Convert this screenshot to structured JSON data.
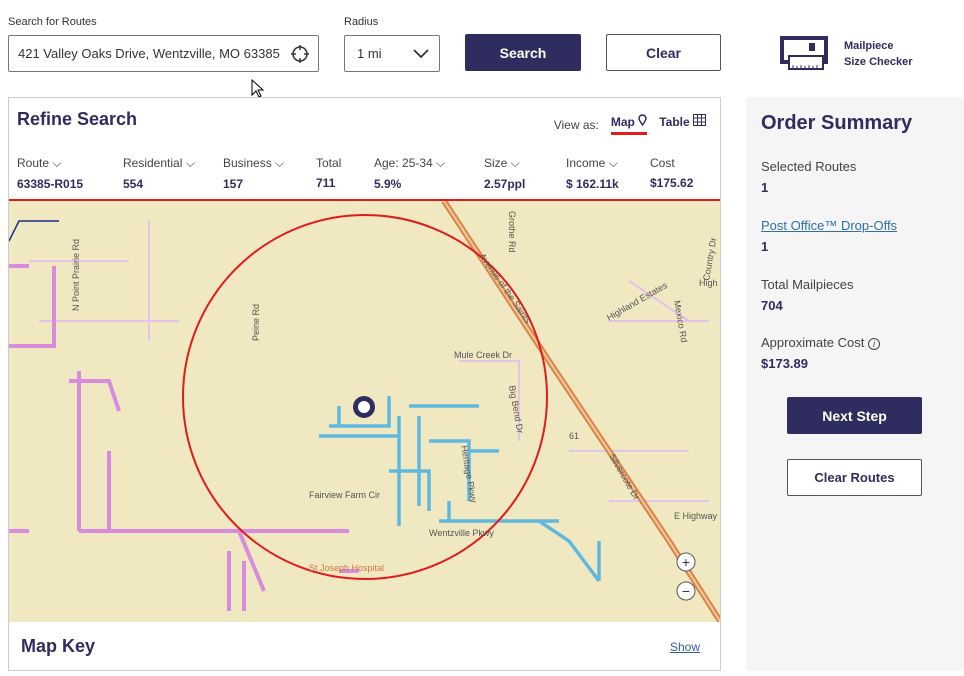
{
  "search": {
    "label": "Search for Routes",
    "value": "421 Valley Oaks Drive, Wentzville, MO 63385",
    "locate_icon": "crosshair-icon"
  },
  "radius": {
    "label": "Radius",
    "value": "1 mi"
  },
  "buttons": {
    "search": "Search",
    "clear": "Clear"
  },
  "mailpiece": {
    "line1": "Mailpiece",
    "line2": "Size Checker",
    "icon": "mailpiece-ruler-icon"
  },
  "refine": {
    "title": "Refine Search",
    "view_as": "View as:",
    "map": "Map",
    "table": "Table",
    "columns": [
      {
        "h": "Route",
        "v": "63385-R015",
        "sort": true
      },
      {
        "h": "Residential",
        "v": "554",
        "sort": true
      },
      {
        "h": "Business",
        "v": "157",
        "sort": true
      },
      {
        "h": "Total",
        "v": "711",
        "sort": false
      },
      {
        "h": "Age: 25-34",
        "v": "5.9%",
        "sort": true
      },
      {
        "h": "Size",
        "v": "2.57ppl",
        "sort": true
      },
      {
        "h": "Income",
        "v": "$ 162.11k",
        "sort": true
      },
      {
        "h": "Cost",
        "v": "$175.62",
        "sort": false
      }
    ]
  },
  "map": {
    "labels": {
      "n_point": "N Point Prairie Rd",
      "peine": "Peine Rd",
      "avenue": "Avenue of the Saints",
      "grothe": "Grothe Rd",
      "highland": "Highland Estates",
      "mexico": "Mexico Rd",
      "mule": "Mule Creek Dr",
      "bigbend": "Big Bend Dr",
      "heritage": "Heritage Pkwy",
      "fairview": "Fairview Farm Cir",
      "wentzville": "Wentzville Pkwy",
      "ehighway": "E Highway",
      "silvercote": "Silvercote Dr",
      "hwy": "61",
      "hospital": "St Joseph Hospital",
      "high": "High",
      "country": "Country Dr"
    },
    "colors": {
      "background": "#f0e8c0",
      "radius": "#e01b1b",
      "routes": "#d98be0",
      "selected_route": "#5fb8e0",
      "highway": "#d9854a"
    },
    "zoom_in": "+",
    "zoom_out": "−"
  },
  "map_key": {
    "title": "Map Key",
    "show": "Show"
  },
  "summary": {
    "title": "Order Summary",
    "selected_routes_label": "Selected Routes",
    "selected_routes": "1",
    "dropoffs_label": "Post Office™ Drop-Offs",
    "dropoffs": "1",
    "total_label": "Total Mailpieces",
    "total": "704",
    "cost_label": "Approximate Cost",
    "cost": "$173.89",
    "next": "Next Step",
    "clear_routes": "Clear Routes"
  }
}
